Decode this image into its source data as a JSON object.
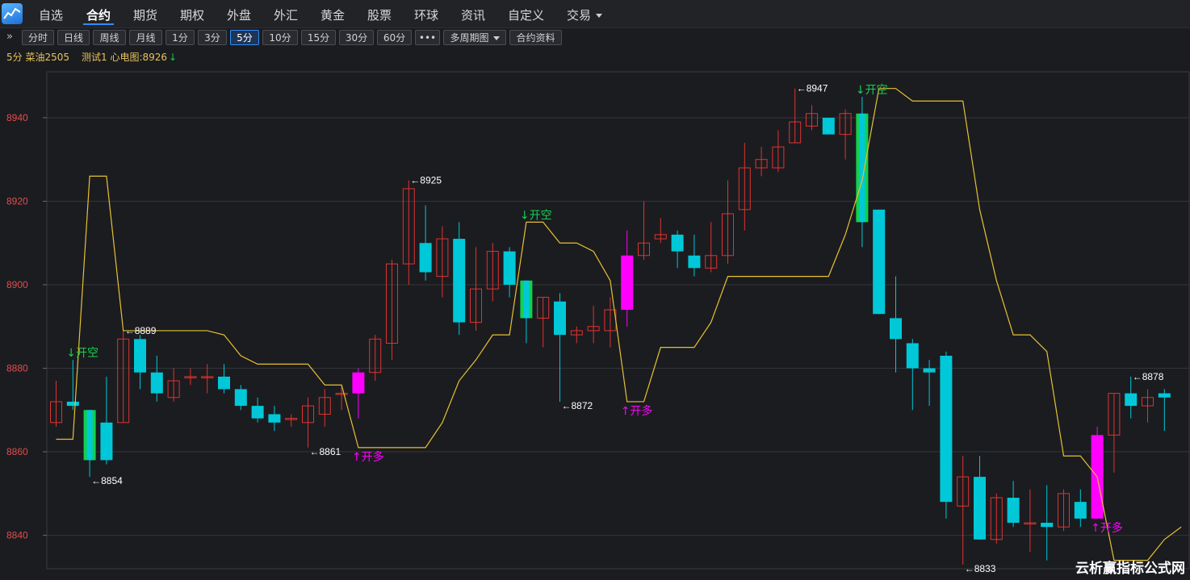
{
  "nav": {
    "items": [
      "自选",
      "合约",
      "期货",
      "期权",
      "外盘",
      "外汇",
      "黄金",
      "股票",
      "环球",
      "资讯",
      "自定义",
      "交易"
    ],
    "active": "合约"
  },
  "toolbar": {
    "expand_icon": "»",
    "periods": [
      "分时",
      "日线",
      "周线",
      "月线",
      "1分",
      "3分",
      "5分",
      "10分",
      "15分",
      "30分",
      "60分"
    ],
    "selected_period": "5分",
    "more_label": "•••",
    "multi_period_label": "多周期图",
    "contract_info_label": "合约资料"
  },
  "info": {
    "symbol": "5分 菜油2505",
    "indicator": "测试1 心电图:8926",
    "indicator_arrow": "↓"
  },
  "watermark": "云析赢指标公式网",
  "colors": {
    "up": "#e0332f",
    "down": "#00c8d8",
    "signal_up": "#ff00ff",
    "signal_down": "#13d04f",
    "line": "#e7c131",
    "axis_label": "#e34d4d",
    "annotation": "#ffffff"
  },
  "chart_data": {
    "type": "candlestick",
    "ylim": [
      8832,
      8951
    ],
    "yticks": [
      8840,
      8860,
      8880,
      8900,
      8920,
      8940
    ],
    "grid": true,
    "candles": [
      {
        "o": 8867,
        "h": 8877,
        "l": 8866,
        "c": 8872
      },
      {
        "o": 8872,
        "h": 8882,
        "l": 8870,
        "c": 8871
      },
      {
        "o": 8870,
        "h": 8870,
        "l": 8854,
        "c": 8858,
        "sig": "down"
      },
      {
        "o": 8867,
        "h": 8878,
        "l": 8857,
        "c": 8858
      },
      {
        "o": 8867,
        "h": 8889,
        "l": 8867,
        "c": 8887
      },
      {
        "o": 8887,
        "h": 8888,
        "l": 8875,
        "c": 8879
      },
      {
        "o": 8879,
        "h": 8883,
        "l": 8872,
        "c": 8874
      },
      {
        "o": 8873,
        "h": 8880,
        "l": 8872,
        "c": 8877
      },
      {
        "o": 8878,
        "h": 8880,
        "l": 8876,
        "c": 8878
      },
      {
        "o": 8878,
        "h": 8881,
        "l": 8874,
        "c": 8878
      },
      {
        "o": 8878,
        "h": 8881,
        "l": 8874,
        "c": 8875
      },
      {
        "o": 8875,
        "h": 8876,
        "l": 8870,
        "c": 8871
      },
      {
        "o": 8871,
        "h": 8873,
        "l": 8867,
        "c": 8868
      },
      {
        "o": 8869,
        "h": 8871,
        "l": 8865,
        "c": 8867
      },
      {
        "o": 8868,
        "h": 8869,
        "l": 8866,
        "c": 8868
      },
      {
        "o": 8867,
        "h": 8873,
        "l": 8861,
        "c": 8871
      },
      {
        "o": 8869,
        "h": 8875,
        "l": 8866,
        "c": 8873
      },
      {
        "o": 8874,
        "h": 8876,
        "l": 8870,
        "c": 8874
      },
      {
        "o": 8874,
        "h": 8880,
        "l": 8868,
        "c": 8879,
        "sig": "up"
      },
      {
        "o": 8879,
        "h": 8888,
        "l": 8877,
        "c": 8887
      },
      {
        "o": 8886,
        "h": 8906,
        "l": 8882,
        "c": 8905
      },
      {
        "o": 8905,
        "h": 8925,
        "l": 8900,
        "c": 8923
      },
      {
        "o": 8910,
        "h": 8919,
        "l": 8901,
        "c": 8903
      },
      {
        "o": 8902,
        "h": 8914,
        "l": 8897,
        "c": 8911
      },
      {
        "o": 8911,
        "h": 8915,
        "l": 8888,
        "c": 8891
      },
      {
        "o": 8891,
        "h": 8909,
        "l": 8889,
        "c": 8899
      },
      {
        "o": 8899,
        "h": 8910,
        "l": 8896,
        "c": 8908
      },
      {
        "o": 8908,
        "h": 8909,
        "l": 8897,
        "c": 8900
      },
      {
        "o": 8901,
        "h": 8901,
        "l": 8886,
        "c": 8892,
        "sig": "down"
      },
      {
        "o": 8892,
        "h": 8897,
        "l": 8885,
        "c": 8897
      },
      {
        "o": 8896,
        "h": 8898,
        "l": 8872,
        "c": 8888
      },
      {
        "o": 8888,
        "h": 8890,
        "l": 8886,
        "c": 8889
      },
      {
        "o": 8889,
        "h": 8895,
        "l": 8886,
        "c": 8890
      },
      {
        "o": 8889,
        "h": 8897,
        "l": 8885,
        "c": 8894
      },
      {
        "o": 8894,
        "h": 8913,
        "l": 8890,
        "c": 8907,
        "sig": "up"
      },
      {
        "o": 8907,
        "h": 8920,
        "l": 8906,
        "c": 8910
      },
      {
        "o": 8911,
        "h": 8916,
        "l": 8910,
        "c": 8912
      },
      {
        "o": 8912,
        "h": 8913,
        "l": 8904,
        "c": 8908
      },
      {
        "o": 8907,
        "h": 8912,
        "l": 8902,
        "c": 8904
      },
      {
        "o": 8904,
        "h": 8915,
        "l": 8903,
        "c": 8907
      },
      {
        "o": 8907,
        "h": 8925,
        "l": 8905,
        "c": 8917
      },
      {
        "o": 8918,
        "h": 8934,
        "l": 8913,
        "c": 8928
      },
      {
        "o": 8928,
        "h": 8933,
        "l": 8926,
        "c": 8930
      },
      {
        "o": 8928,
        "h": 8937,
        "l": 8927,
        "c": 8933
      },
      {
        "o": 8934,
        "h": 8947,
        "l": 8934,
        "c": 8939
      },
      {
        "o": 8938,
        "h": 8943,
        "l": 8937,
        "c": 8941
      },
      {
        "o": 8940,
        "h": 8940,
        "l": 8936,
        "c": 8936
      },
      {
        "o": 8936,
        "h": 8942,
        "l": 8930,
        "c": 8941
      },
      {
        "o": 8941,
        "h": 8945,
        "l": 8909,
        "c": 8915,
        "sig": "down"
      },
      {
        "o": 8918,
        "h": 8918,
        "l": 8893,
        "c": 8893
      },
      {
        "o": 8892,
        "h": 8902,
        "l": 8879,
        "c": 8887
      },
      {
        "o": 8886,
        "h": 8887,
        "l": 8870,
        "c": 8880
      },
      {
        "o": 8880,
        "h": 8882,
        "l": 8871,
        "c": 8879
      },
      {
        "o": 8883,
        "h": 8884,
        "l": 8844,
        "c": 8848
      },
      {
        "o": 8847,
        "h": 8859,
        "l": 8833,
        "c": 8854
      },
      {
        "o": 8854,
        "h": 8859,
        "l": 8839,
        "c": 8839
      },
      {
        "o": 8839,
        "h": 8850,
        "l": 8838,
        "c": 8849
      },
      {
        "o": 8849,
        "h": 8853,
        "l": 8842,
        "c": 8843
      },
      {
        "o": 8843,
        "h": 8851,
        "l": 8836,
        "c": 8843
      },
      {
        "o": 8843,
        "h": 8852,
        "l": 8834,
        "c": 8842
      },
      {
        "o": 8842,
        "h": 8851,
        "l": 8841,
        "c": 8850
      },
      {
        "o": 8848,
        "h": 8851,
        "l": 8842,
        "c": 8844
      },
      {
        "o": 8844,
        "h": 8866,
        "l": 8844,
        "c": 8864,
        "sig": "up"
      },
      {
        "o": 8864,
        "h": 8874,
        "l": 8855,
        "c": 8874
      },
      {
        "o": 8874,
        "h": 8878,
        "l": 8868,
        "c": 8871
      },
      {
        "o": 8871,
        "h": 8875,
        "l": 8867,
        "c": 8873
      },
      {
        "o": 8874,
        "h": 8875,
        "l": 8865,
        "c": 8873
      }
    ],
    "line": [
      8863,
      8863,
      8926,
      8926,
      8889,
      8889,
      8889,
      8889,
      8889,
      8889,
      8888,
      8883,
      8881,
      8881,
      8881,
      8881,
      8876,
      8876,
      8861,
      8861,
      8861,
      8861,
      8861,
      8867,
      8877,
      8882,
      8888,
      8888,
      8915,
      8915,
      8910,
      8910,
      8908,
      8901,
      8872,
      8872,
      8885,
      8885,
      8885,
      8891,
      8902,
      8902,
      8902,
      8902,
      8902,
      8902,
      8902,
      8912,
      8925,
      8947,
      8947,
      8944,
      8944,
      8944,
      8944,
      8918,
      8901,
      8888,
      8888,
      8884,
      8859,
      8859,
      8854,
      8834,
      8834,
      8834,
      8839,
      8842
    ],
    "annotations": [
      {
        "i": 2,
        "label": "←8854",
        "pos": "low"
      },
      {
        "i": 4,
        "label": "←8889",
        "pos": "high"
      },
      {
        "i": 15,
        "label": "←8861",
        "pos": "low"
      },
      {
        "i": 21,
        "label": "←8925",
        "pos": "high"
      },
      {
        "i": 30,
        "label": "←8872",
        "pos": "low"
      },
      {
        "i": 44,
        "label": "←8947",
        "pos": "high"
      },
      {
        "i": 54,
        "label": "←8833",
        "pos": "low"
      },
      {
        "i": 64,
        "label": "←8878",
        "pos": "high"
      }
    ],
    "signals": [
      {
        "i": 1,
        "label": "↓开空",
        "type": "short"
      },
      {
        "i": 18,
        "label": "↑开多",
        "type": "long"
      },
      {
        "i": 28,
        "label": "↓开空",
        "type": "short"
      },
      {
        "i": 34,
        "label": "↑开多",
        "type": "long"
      },
      {
        "i": 48,
        "label": "↓开空",
        "type": "short"
      },
      {
        "i": 62,
        "label": "↑开多",
        "type": "long"
      }
    ]
  }
}
